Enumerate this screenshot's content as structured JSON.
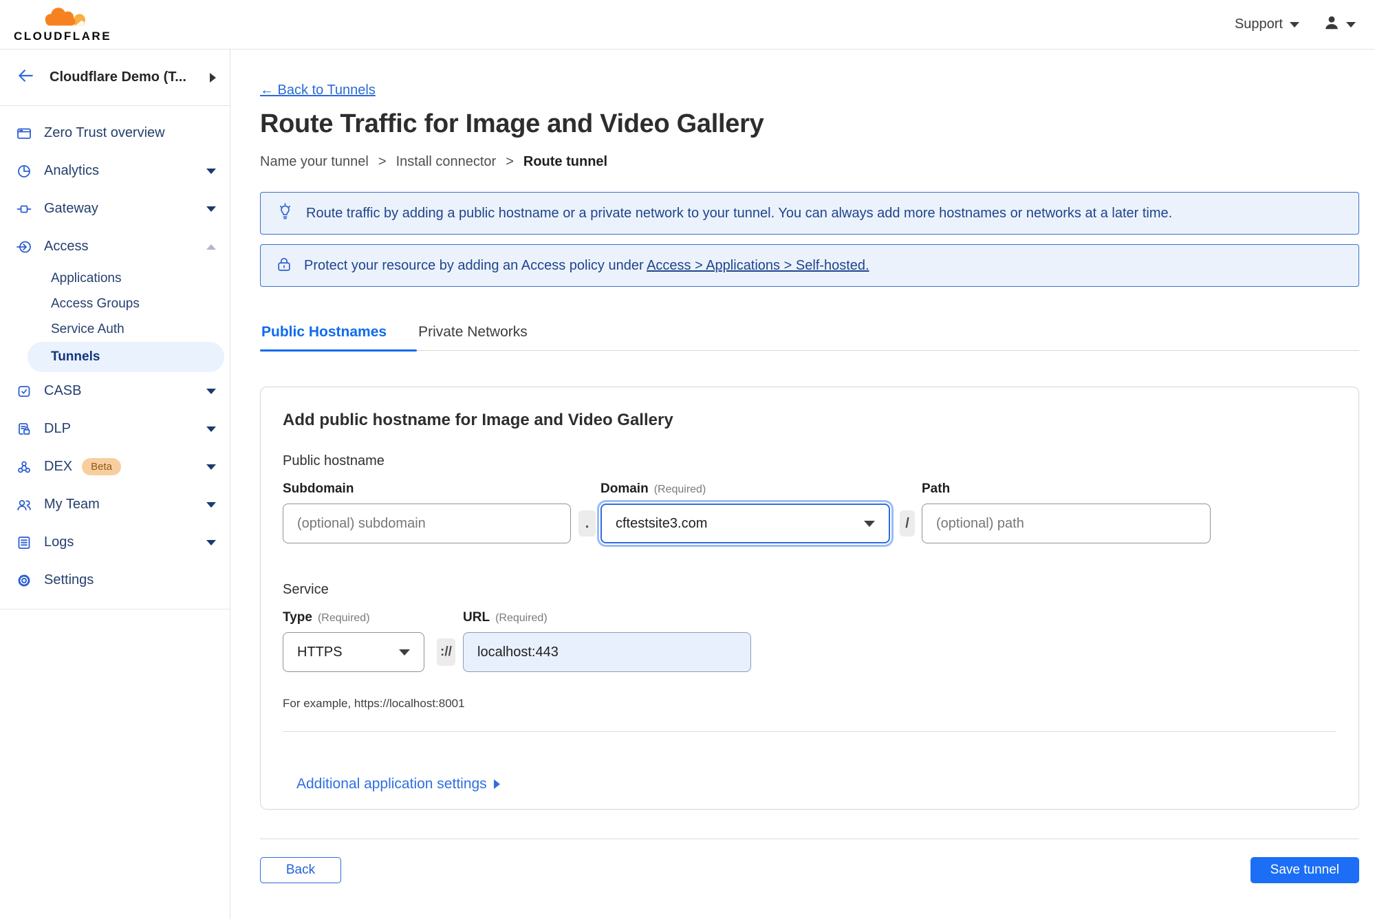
{
  "topbar": {
    "brand": "CLOUDFLARE",
    "support_label": "Support"
  },
  "sidebar": {
    "account_name": "Cloudflare Demo (T...",
    "beta_badge": "Beta",
    "items": [
      {
        "label": "Zero Trust overview"
      },
      {
        "label": "Analytics"
      },
      {
        "label": "Gateway"
      },
      {
        "label": "Access"
      },
      {
        "label": "Applications"
      },
      {
        "label": "Access Groups"
      },
      {
        "label": "Service Auth"
      },
      {
        "label": "Tunnels"
      },
      {
        "label": "CASB"
      },
      {
        "label": "DLP"
      },
      {
        "label": "DEX"
      },
      {
        "label": "My Team"
      },
      {
        "label": "Logs"
      },
      {
        "label": "Settings"
      }
    ]
  },
  "main": {
    "back_link": "← Back to Tunnels",
    "title": "Route Traffic for Image and Video Gallery",
    "breadcrumb": {
      "separator": ">",
      "steps": [
        "Name your tunnel",
        "Install connector",
        "Route tunnel"
      ]
    },
    "banners": [
      {
        "icon": "lightbulb-icon",
        "text": "Route traffic by adding a public hostname or a private network to your tunnel. You can always add more hostnames or networks at a later time."
      },
      {
        "icon": "lock-icon",
        "text_before": "Protect your resource by adding an Access policy under ",
        "link": "Access > Applications > Self-hosted."
      }
    ],
    "tabs": [
      {
        "label": "Public Hostnames"
      },
      {
        "label": "Private Networks"
      }
    ],
    "form": {
      "heading": "Add public hostname for Image and Video Gallery",
      "hostname_group_label": "Public hostname",
      "subdomain": {
        "label": "Subdomain",
        "placeholder": "(optional) subdomain"
      },
      "dot_separator": ".",
      "domain": {
        "label": "Domain",
        "required_tag": "(Required)",
        "value": "cftestsite3.com"
      },
      "slash_separator": "/",
      "path": {
        "label": "Path",
        "placeholder": "(optional) path"
      },
      "service_group_label": "Service",
      "type": {
        "label": "Type",
        "required_tag": "(Required)",
        "value": "HTTPS"
      },
      "scheme_separator": "://",
      "url": {
        "label": "URL",
        "required_tag": "(Required)",
        "value": "localhost:443"
      },
      "example_hint": "For example, https://localhost:8001",
      "additional_settings_label": "Additional application settings"
    },
    "footer": {
      "back_label": "Back",
      "save_label": "Save tunnel"
    }
  },
  "colors": {
    "accent_blue": "#1b6ef5",
    "link_blue": "#2a6ad6",
    "tab_active_blue": "#0f6bed",
    "banner_bg": "#ebf2fc",
    "banner_border": "#3a70c9",
    "banner_text": "#20448c",
    "active_pill_bg": "#e9f2fd",
    "nav_text": "#243f6e",
    "icon_blue": "#2d5fd0",
    "brand_orange": "#f6821f",
    "brand_orange_light": "#fbad41",
    "beta_bg": "#f9ce9e",
    "beta_text": "#8a5a18"
  }
}
